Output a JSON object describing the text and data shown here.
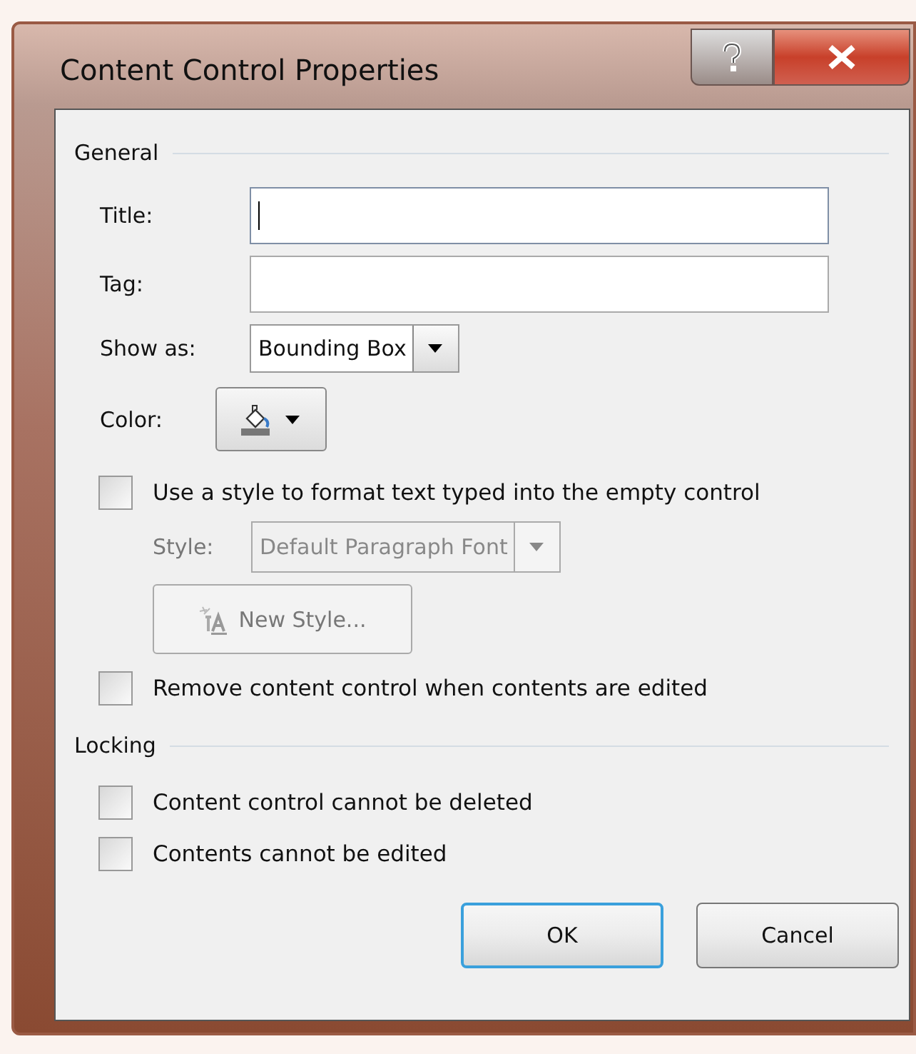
{
  "window": {
    "title": "Content Control Properties"
  },
  "general": {
    "heading": "General",
    "fields": [
      {
        "kind": "text",
        "label": "Title:",
        "focused": true
      },
      {
        "kind": "text",
        "label": "Tag:",
        "focused": false
      },
      {
        "kind": "dropdown",
        "label": "Show as:",
        "value": "Bounding Box"
      },
      {
        "kind": "color",
        "label": "Color:"
      }
    ],
    "options": [
      {
        "kind": "checkbox",
        "label": "Use a style to format text typed into the empty control",
        "checked": false
      },
      {
        "kind": "dropdown",
        "label": "Style:",
        "value": "Default Paragraph Font",
        "disabled": true
      },
      {
        "kind": "button",
        "label": "New Style...",
        "disabled": true
      },
      {
        "kind": "checkbox",
        "label": "Remove content control when contents are edited",
        "checked": false
      }
    ]
  },
  "locking": {
    "heading": "Locking",
    "options": [
      {
        "kind": "checkbox",
        "label": "Content control cannot be deleted",
        "checked": false
      },
      {
        "kind": "checkbox",
        "label": "Contents cannot be edited",
        "checked": false
      }
    ]
  },
  "buttons": [
    {
      "label": "OK",
      "default": true
    },
    {
      "label": "Cancel",
      "default": false
    }
  ]
}
